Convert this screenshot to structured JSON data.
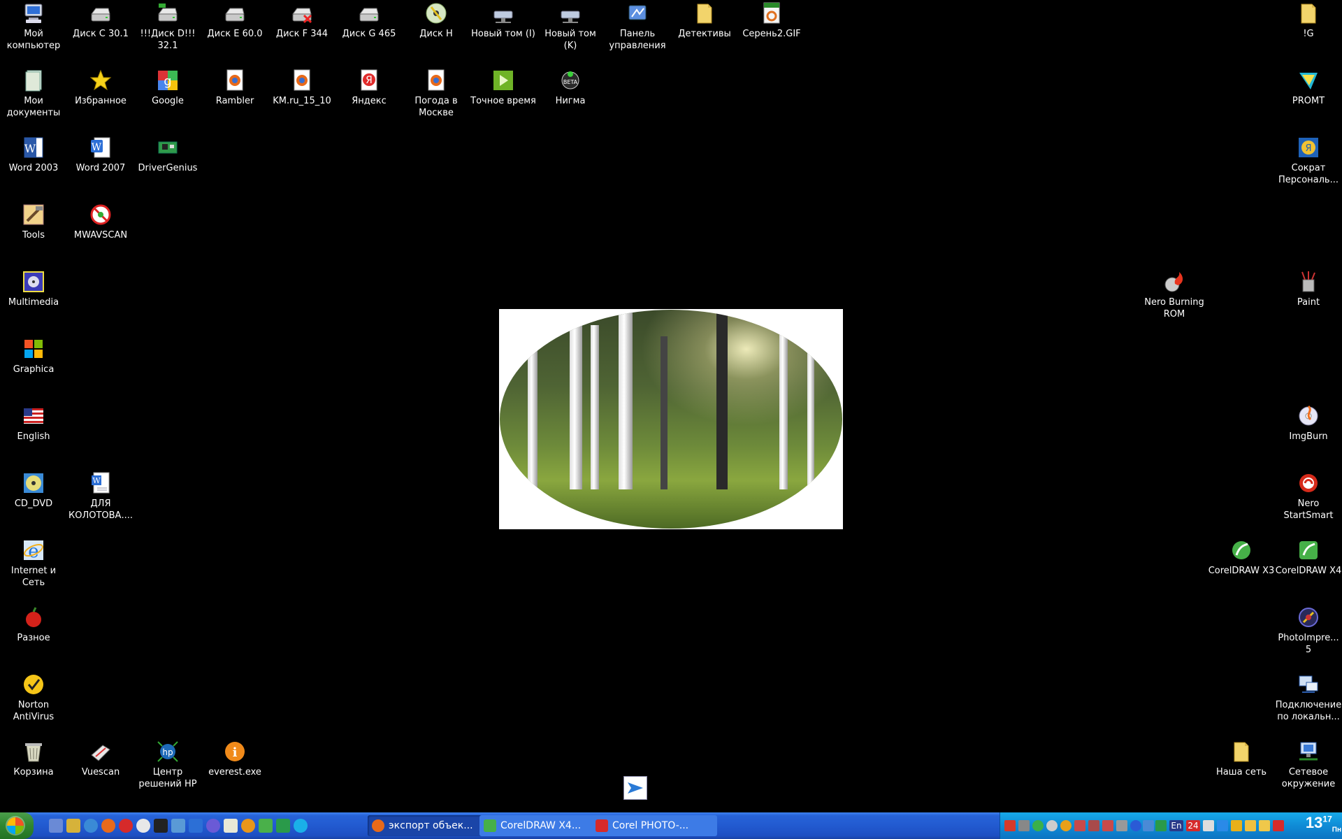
{
  "desktop": {
    "icons": {
      "my_computer": "Мой компьютер",
      "disk_c": "Диск С 30.1",
      "disk_d": "!!!Диск D!!! 32.1",
      "disk_e": "Диск Е 60.0",
      "disk_f": "Диск F 344",
      "disk_g": "Диск G 465",
      "disk_h": "Диск H",
      "vol_i": "Новый том (I)",
      "vol_k": "Новый том (K)",
      "control_panel": "Панель управления",
      "detectives": "Детективы",
      "serenj_gif": "Серень2.GIF",
      "ig_folder": "!G",
      "my_documents": "Мои документы",
      "favorites": "Избранное",
      "google": "Google",
      "rambler": "Rambler",
      "km": "KM.ru_15_10",
      "yandex": "Яндекс",
      "weather": "Погода в Москве",
      "exact_time": "Точное время",
      "nigma": "Нигма",
      "promt": "PROMT",
      "word2003": "Word 2003",
      "word2007": "Word 2007",
      "drivergenius": "DriverGenius",
      "sokrat": "Сократ Персональ...",
      "tools": "Tools",
      "mwavscan": "MWAVSCAN",
      "multimedia": "Multimedia",
      "nero_burning": "Nero Burning ROM",
      "paint": "Paint",
      "graphica": "Graphica",
      "english": "English",
      "imgburn": "ImgBurn",
      "cd_dvd": "CD_DVD",
      "dlya_kolotova": "ДЛЯ КОЛОТОВА....",
      "nero_startsmart": "Nero StartSmart",
      "internet": "Internet и Сеть",
      "coreldraw_x3": "CorelDRAW X3",
      "coreldraw_x4": "CorelDRAW X4",
      "raznoe": "Разное",
      "photoimpression": "PhotoImpre... 5",
      "norton": "Norton AntiVirus",
      "lan_connection": "Подключение по локальн...",
      "recycle_bin": "Корзина",
      "vuescan": "Vuescan",
      "hp_center": "Центр решений HP",
      "everest": "everest.exe",
      "our_network": "Наша сеть",
      "network_places": "Сетевое окружение"
    }
  },
  "taskbar": {
    "tasks": [
      {
        "label": "экспорт объек..."
      },
      {
        "label": "CorelDRAW X4..."
      },
      {
        "label": "Corel PHOTO-..."
      }
    ],
    "tray": {
      "lang": "En",
      "badge": "24"
    },
    "clock": {
      "hour": "13",
      "minute": "17",
      "day": "Пн"
    }
  },
  "colors": {
    "desktop_bg": "#000000",
    "taskbar_blue": "#225ad0",
    "tray_blue": "#0f8bd6",
    "start_green": "#2f862f"
  }
}
